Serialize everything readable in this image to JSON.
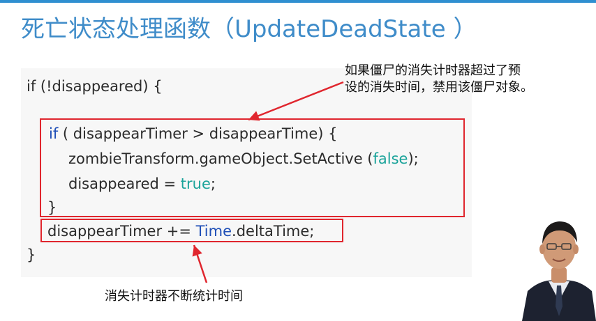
{
  "slide": {
    "title": "死亡状态处理函数（UpdateDeadState ）"
  },
  "code": {
    "line1": "if (!disappeared) {",
    "line2_kw": "if",
    "line2_rest": " ( disappearTimer > disappearTime) {",
    "line3_pre": "zombieTransform.gameObject.SetActive (",
    "line3_val": "false",
    "line3_post": ");",
    "line4_pre": "disappeared = ",
    "line4_val": "true",
    "line4_post": ";",
    "line5": "}",
    "line6_pre": "disappearTimer += ",
    "line6_kw": "Time",
    "line6_post": ".deltaTime;",
    "line7": "}"
  },
  "annotations": {
    "top_line1": "如果僵尸的消失计时器超过了预",
    "top_line2": "设的消失时间，禁用该僵尸对象。",
    "bottom": "消失计时器不断统计时间"
  },
  "colors": {
    "title": "#3f8cc9",
    "keyword_blue": "#1f4fb7",
    "keyword_teal": "#1aa39a",
    "highlight_box": "#e0262e"
  }
}
